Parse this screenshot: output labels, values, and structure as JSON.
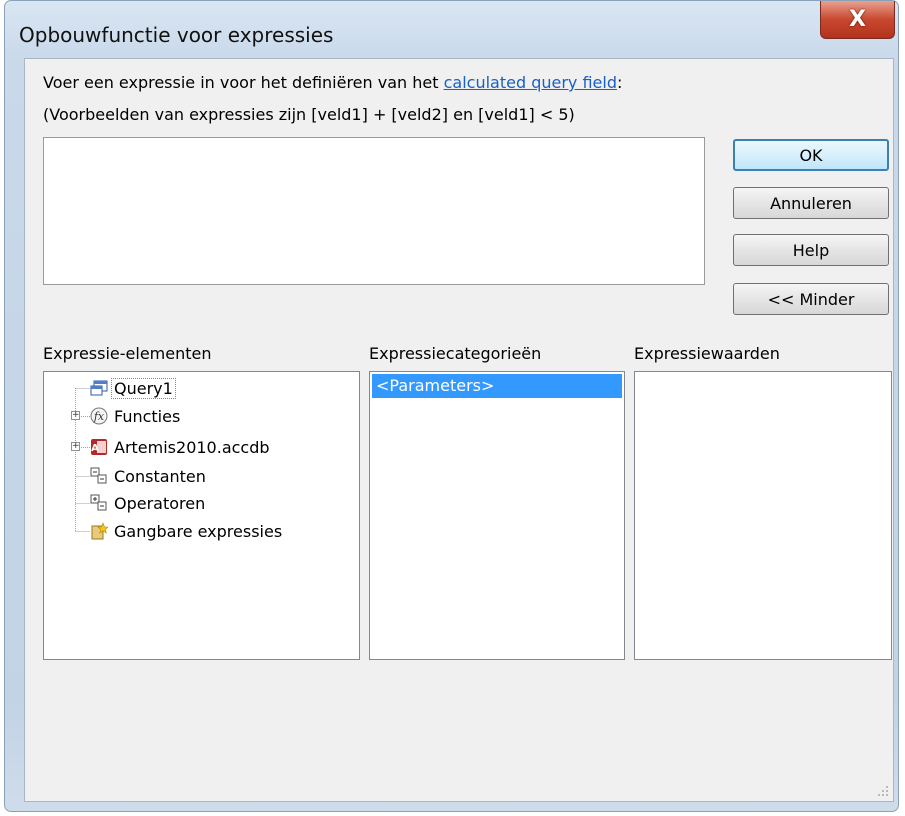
{
  "window": {
    "title": "Opbouwfunctie voor expressies",
    "close_glyph": "X"
  },
  "instructions": {
    "line1_prefix": "Voer een expressie in voor het definiëren van het ",
    "line1_link": "calculated query field",
    "line1_suffix": ":",
    "line2": "(Voorbeelden van expressies zijn [veld1] + [veld2] en [veld1] < 5)"
  },
  "expression_input": {
    "value": ""
  },
  "buttons": {
    "ok": "OK",
    "cancel": "Annuleren",
    "help": "Help",
    "less": "<< Minder"
  },
  "panels": {
    "elements_label": "Expressie-elementen",
    "categories_label": "Expressiecategorieën",
    "values_label": "Expressiewaarden"
  },
  "tree": [
    {
      "label": "Query1",
      "icon": "query-icon",
      "expandable": false
    },
    {
      "label": "Functies",
      "icon": "function-icon",
      "expandable": true
    },
    {
      "label": "Artemis2010.accdb",
      "icon": "access-database-icon",
      "expandable": true
    },
    {
      "label": "Constanten",
      "icon": "constants-icon",
      "expandable": false
    },
    {
      "label": "Operatoren",
      "icon": "operators-icon",
      "expandable": false
    },
    {
      "label": "Gangbare expressies",
      "icon": "common-expressions-icon",
      "expandable": false
    }
  ],
  "categories": [
    {
      "label": "<Parameters>",
      "selected": true
    }
  ],
  "colors": {
    "selection": "#3399ff",
    "link": "#1a5fc4",
    "close_button": "#c8482f"
  }
}
